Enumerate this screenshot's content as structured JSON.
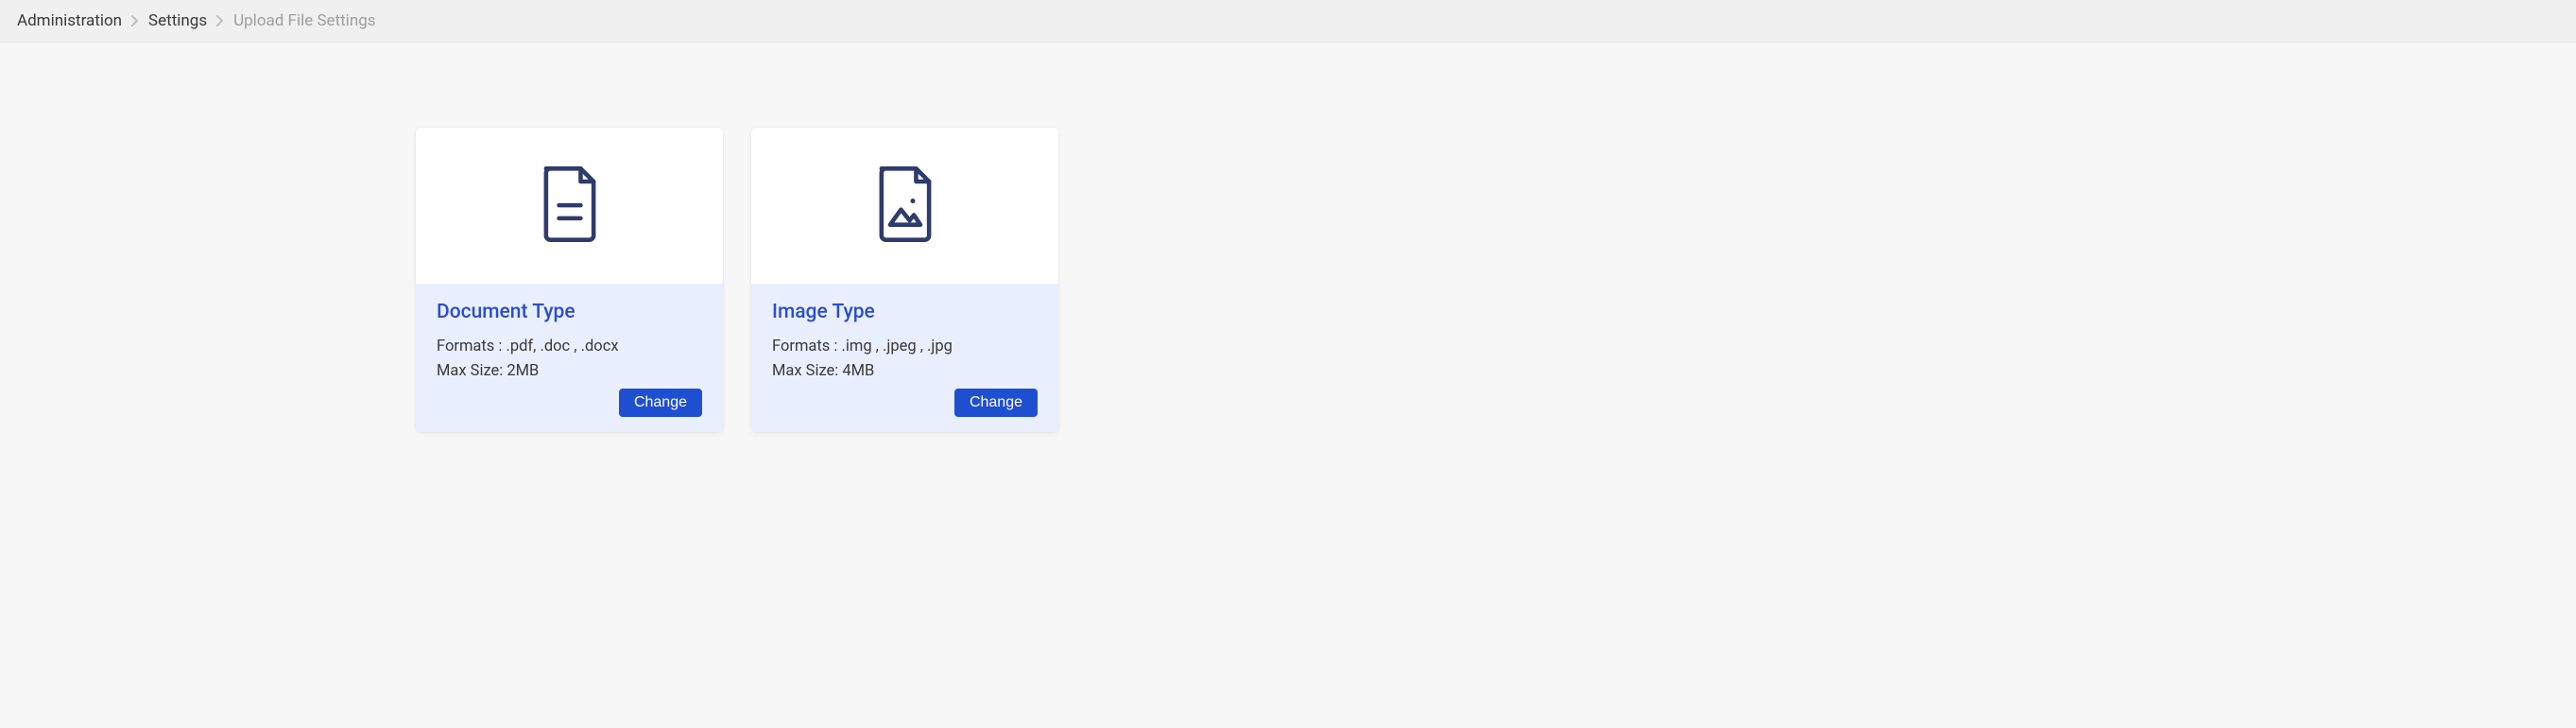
{
  "breadcrumb": {
    "items": [
      {
        "label": "Administration"
      },
      {
        "label": "Settings"
      },
      {
        "label": "Upload File Settings"
      }
    ]
  },
  "cards": [
    {
      "icon": "file-document-icon",
      "title": "Document Type",
      "formats_line": "Formats : .pdf, .doc , .docx",
      "size_line": "Max Size: 2MB",
      "button_label": "Change"
    },
    {
      "icon": "file-image-icon",
      "title": "Image Type",
      "formats_line": "Formats : .img , .jpeg , .jpg",
      "size_line": "Max Size: 4MB",
      "button_label": "Change"
    }
  ]
}
